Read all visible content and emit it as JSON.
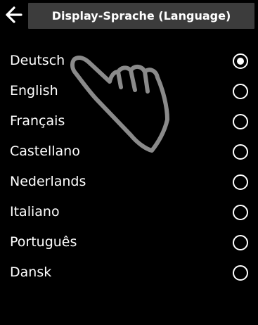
{
  "header": {
    "back_icon": "arrow-left-icon",
    "title": "Display-Sprache (Language)"
  },
  "languages": [
    {
      "label": "Deutsch",
      "selected": true
    },
    {
      "label": "English",
      "selected": false
    },
    {
      "label": "Français",
      "selected": false
    },
    {
      "label": "Castellano",
      "selected": false
    },
    {
      "label": "Nederlands",
      "selected": false
    },
    {
      "label": "Italiano",
      "selected": false
    },
    {
      "label": "Português",
      "selected": false
    },
    {
      "label": "Dansk",
      "selected": false
    }
  ],
  "overlay": {
    "icon": "pointing-hand-icon"
  },
  "colors": {
    "background": "#000000",
    "title_bar": "#3c3c3c",
    "text": "#ffffff",
    "hand_outline": "#8a8a8a"
  }
}
